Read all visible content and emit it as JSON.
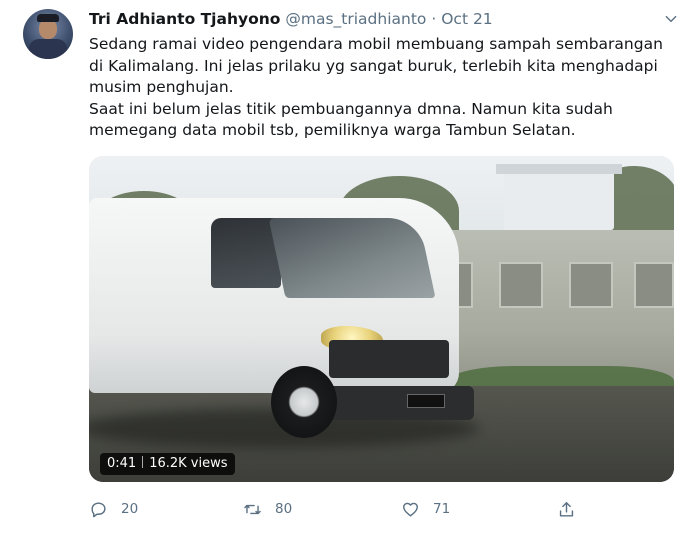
{
  "tweet": {
    "author_name": "Tri Adhianto Tjahyono",
    "handle": "@mas_triadhianto",
    "separator": "·",
    "date": "Oct 21",
    "text_paragraph_1": "Sedang ramai video pengendara mobil membuang sampah sembarangan di Kalimalang. Ini jelas prilaku yg sangat buruk, terlebih kita menghadapi musim penghujan.",
    "text_paragraph_2": "Saat ini belum jelas titik pembuangannya dmna. Namun kita sudah memegang data mobil tsb, pemiliknya warga Tambun Selatan.",
    "video": {
      "duration": "0:41",
      "views": "16.2K views"
    },
    "actions": {
      "reply_count": "20",
      "retweet_count": "80",
      "like_count": "71"
    }
  },
  "colors": {
    "text_primary": "#14171a",
    "text_secondary": "#5b7083"
  },
  "icons": [
    "chevron-down-icon",
    "reply-icon",
    "retweet-icon",
    "like-icon",
    "share-icon"
  ]
}
